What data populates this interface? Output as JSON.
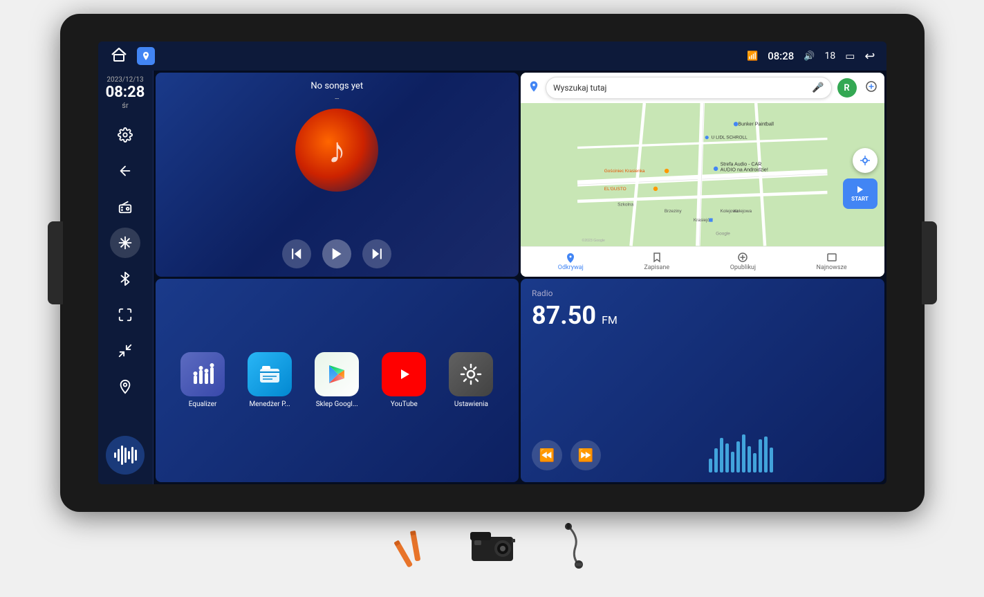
{
  "device": {
    "screenWidth": 1140,
    "screenHeight": 640
  },
  "statusBar": {
    "homeLabel": "🏠",
    "mapsIconLabel": "📍",
    "time": "08:28",
    "volumeIcon": "🔊",
    "volumeLevel": "18",
    "batteryIcon": "🔋",
    "wifiIcon": "📶",
    "backIcon": "↩"
  },
  "sidebar": {
    "date": "2023/12/13",
    "time": "08:28",
    "day": "śr",
    "icons": [
      {
        "name": "settings-icon",
        "label": "Ustawienia",
        "active": false
      },
      {
        "name": "back-icon",
        "label": "Wstecz",
        "active": false
      },
      {
        "name": "radio-icon",
        "label": "Radio",
        "active": false
      },
      {
        "name": "snowflake-icon",
        "label": "AC",
        "active": true
      },
      {
        "name": "bluetooth-icon",
        "label": "Bluetooth",
        "active": false
      },
      {
        "name": "expand-icon",
        "label": "Rozwiń",
        "active": false
      },
      {
        "name": "contract-icon",
        "label": "Zwiń",
        "active": false
      },
      {
        "name": "location-icon",
        "label": "Lokalizacja",
        "active": false
      }
    ],
    "voiceLabel": "Głos"
  },
  "musicPanel": {
    "title": "No songs yet",
    "subtitle": "--",
    "prevLabel": "⏮",
    "playLabel": "▶",
    "nextLabel": "⏭"
  },
  "mapPanel": {
    "searchPlaceholder": "Wyszukaj tutaj",
    "places": [
      "Bunker Paintball",
      "Gosciniec Krasienka",
      "EL'GUSTO",
      "U LIDL SCHROLL",
      "Strefa Audio - CAR AUDIO na Androidzie !",
      "Brzeziny",
      "Krasiejów",
      "Kolejowa",
      "Szkolna"
    ],
    "footerItems": [
      {
        "label": "Odkrywaj",
        "active": true
      },
      {
        "label": "Zapisane",
        "active": false
      },
      {
        "label": "Opublikuj",
        "active": false
      },
      {
        "label": "Najnowsze",
        "active": false
      }
    ],
    "startLabel": "START",
    "copyright": "©2023 Google"
  },
  "appsPanel": {
    "apps": [
      {
        "name": "equalizer-app",
        "label": "Equalizer",
        "icon": "equalizer"
      },
      {
        "name": "files-app",
        "label": "Menedżer P...",
        "icon": "files"
      },
      {
        "name": "playstore-app",
        "label": "Sklep Googl...",
        "icon": "playstore"
      },
      {
        "name": "youtube-app",
        "label": "YouTube",
        "icon": "youtube"
      },
      {
        "name": "settings-app",
        "label": "Ustawienia",
        "icon": "settings"
      }
    ]
  },
  "radioPanel": {
    "label": "Radio",
    "frequency": "87.50",
    "band": "FM",
    "rewindLabel": "⏪",
    "forwardLabel": "⏩",
    "bars": [
      20,
      35,
      50,
      42,
      30,
      45,
      55,
      38,
      28,
      48,
      52,
      36
    ]
  },
  "accessories": [
    {
      "name": "pry-tool",
      "color": "#e8742a"
    },
    {
      "name": "camera",
      "color": "#222"
    },
    {
      "name": "microphone-cable",
      "color": "#444"
    }
  ]
}
